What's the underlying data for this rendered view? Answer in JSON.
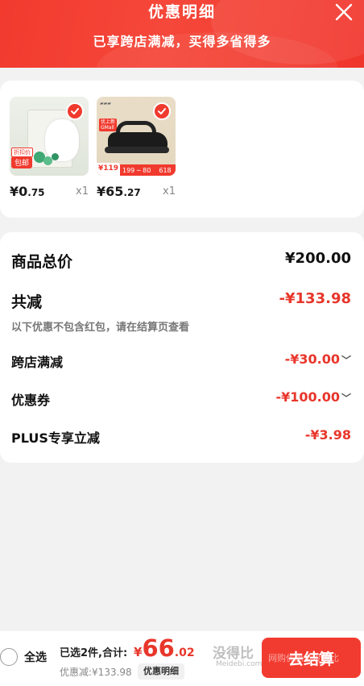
{
  "header": {
    "title": "优惠明细",
    "subtitle": "已享跨店满减，买得多省得多"
  },
  "products": [
    {
      "name": "面膜",
      "price_int": "¥0",
      "price_dec": ".75",
      "qty": "x1",
      "badge": "包邮",
      "badge_small": "折扣价"
    },
    {
      "name": "凉鞋",
      "price_int": "¥65",
      "price_dec": ".27",
      "qty": "x1",
      "promo_price": "¥119",
      "promo_nums": "199 ─ 80",
      "promo_618": "618",
      "tag": "优上新",
      "tag2": "GMall"
    }
  ],
  "summary": {
    "total_label": "商品总价",
    "total_value": "¥200.00",
    "reduce_label": "共减",
    "reduce_value": "-¥133.98",
    "note": "以下优惠不包含红包，请在结算页查看",
    "items": [
      {
        "label": "跨店满减",
        "value": "-¥30.00",
        "expandable": true
      },
      {
        "label": "优惠券",
        "value": "-¥100.00",
        "expandable": true
      },
      {
        "label": "PLUS专享立减",
        "value": "-¥3.98",
        "expandable": false
      }
    ]
  },
  "bottom": {
    "select_all": "全选",
    "selected_info": "已选2件,合计:",
    "currency": "¥",
    "total_int": "66",
    "total_dec": ".02",
    "discount": "优惠减:¥133.98",
    "detail_btn": "优惠明细",
    "checkout": "去结算"
  },
  "watermark": {
    "main": "没得比",
    "sub": "Meidebi.com",
    "overlay": "网购优惠上没得比"
  },
  "colors": {
    "accent": "#f23a2f",
    "price_red": "#e8362b",
    "background": "#f2f2f2"
  },
  "icons": [
    "close-icon",
    "check-icon",
    "chevron-down-icon",
    "radio-icon"
  ]
}
